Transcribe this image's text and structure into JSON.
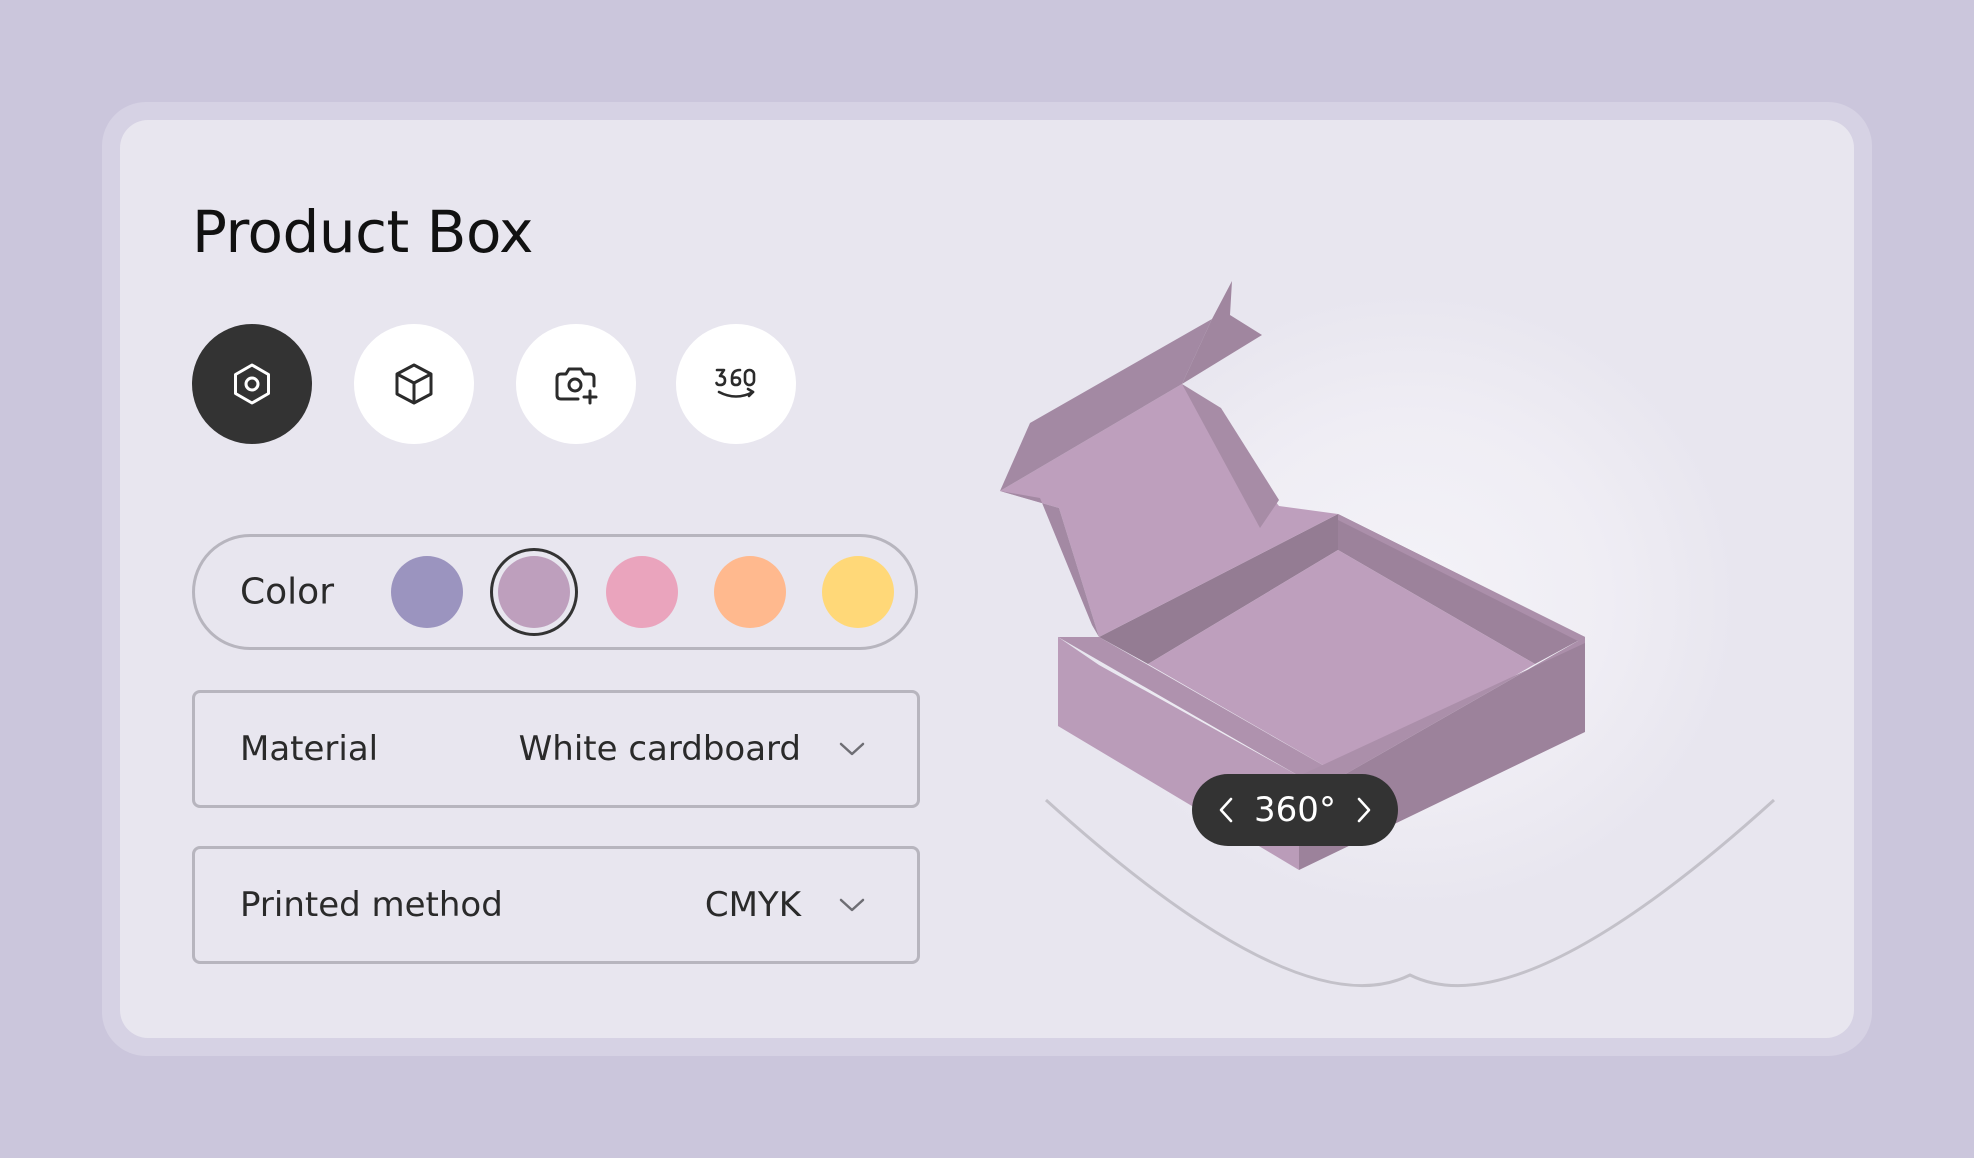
{
  "product": {
    "title": "Product Box"
  },
  "view_modes": [
    {
      "id": "ar",
      "icon": "hexagon-dot-icon",
      "active": true
    },
    {
      "id": "3d",
      "icon": "cube-icon",
      "active": false
    },
    {
      "id": "photo",
      "icon": "camera-add-icon",
      "active": false
    },
    {
      "id": "spin",
      "icon": "360-view-icon",
      "active": false
    }
  ],
  "color": {
    "label": "Color",
    "options": [
      "#9b94bf",
      "#be9fbd",
      "#eaa4bd",
      "#ffb98e",
      "#ffd878"
    ],
    "selected_index": 1
  },
  "material": {
    "label": "Material",
    "value": "White cardboard"
  },
  "printed_method": {
    "label": "Printed method",
    "value": "CMYK"
  },
  "viewer": {
    "rotation_label": "360°",
    "box_color": "#be9fbd"
  },
  "theme": {
    "background": "#cbc6dc",
    "card": "#e8e6ef",
    "dark": "#333333"
  }
}
